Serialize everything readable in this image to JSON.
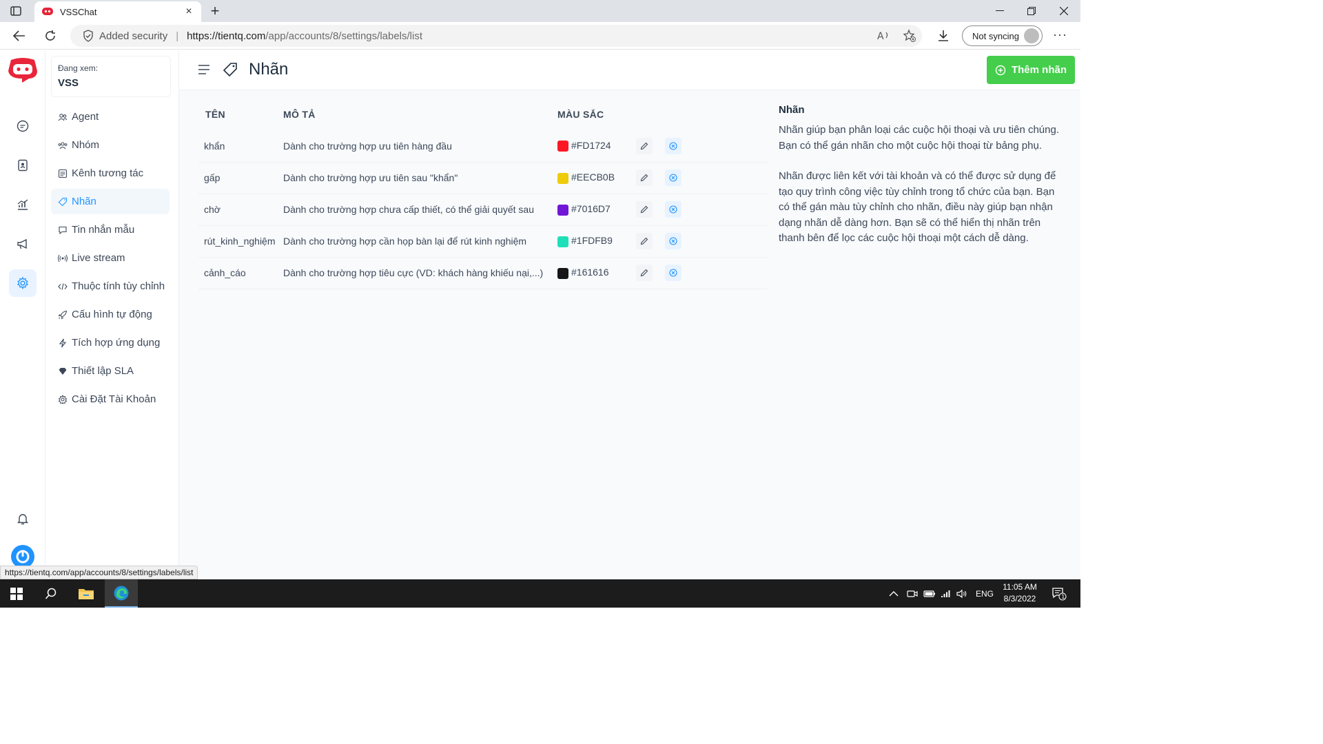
{
  "browser": {
    "tab_title": "VSSChat",
    "security_text": "Added security",
    "url_host": "https://tientq.com",
    "url_path": "/app/accounts/8/settings/labels/list",
    "sync_label": "Not syncing",
    "status_url": "https://tientq.com/app/accounts/8/settings/labels/list"
  },
  "sidebar": {
    "viewing_label": "Đang xem:",
    "account_name": "VSS",
    "items": [
      {
        "label": "Agent",
        "icon": "people-icon"
      },
      {
        "label": "Nhóm",
        "icon": "team-icon"
      },
      {
        "label": "Kênh tương tác",
        "icon": "inbox-icon"
      },
      {
        "label": "Nhãn",
        "icon": "tag-icon"
      },
      {
        "label": "Tin nhắn mẫu",
        "icon": "chat-icon"
      },
      {
        "label": "Live stream",
        "icon": "broadcast-icon"
      },
      {
        "label": "Thuộc tính tùy chỉnh",
        "icon": "code-icon"
      },
      {
        "label": "Cấu hình tự động",
        "icon": "automation-icon"
      },
      {
        "label": "Tích hợp ứng dụng",
        "icon": "flash-icon"
      },
      {
        "label": "Thiết lập SLA",
        "icon": "diamond-icon"
      },
      {
        "label": "Cài Đặt Tài Khoản",
        "icon": "gear-icon"
      }
    ]
  },
  "header": {
    "title": "Nhãn",
    "add_button": "Thêm nhãn"
  },
  "table": {
    "columns": [
      "TÊN",
      "MÔ TẢ",
      "MÀU SẮC"
    ],
    "rows": [
      {
        "name": "khẩn",
        "description": "Dành cho trường hợp ưu tiên hàng đầu",
        "color": "#FD1724"
      },
      {
        "name": "gấp",
        "description": "Dành cho trường hợp ưu tiên sau \"khẩn\"",
        "color": "#EECB0B"
      },
      {
        "name": "chờ",
        "description": "Dành cho trường hợp chưa cấp thiết, có thể giải quyết sau",
        "color": "#7016D7"
      },
      {
        "name": "rút_kinh_nghiệm",
        "description": "Dành cho trường hợp cần họp bàn lại để rút kinh nghiệm",
        "color": "#1FDFB9"
      },
      {
        "name": "cảnh_cáo",
        "description": "Dành cho trường hợp tiêu cực (VD: khách hàng khiếu nại,...)",
        "color": "#161616"
      }
    ]
  },
  "help": {
    "title": "Nhãn",
    "paragraph1": "Nhãn giúp bạn phân loại các cuộc hội thoại và ưu tiên chúng. Bạn có thể gán nhãn cho một cuộc hội thoại từ bảng phụ.",
    "paragraph2": "Nhãn được liên kết với tài khoản và có thể được sử dụng để tạo quy trình công việc tùy chỉnh trong tổ chức của bạn. Bạn có thể gán màu tùy chỉnh cho nhãn, điều này giúp bạn nhận dạng nhãn dễ dàng hơn. Bạn sẽ có thể hiển thị nhãn trên thanh bên để lọc các cuộc hội thoại một cách dễ dàng."
  },
  "taskbar": {
    "language": "ENG",
    "time": "11:05 AM",
    "date": "8/3/2022",
    "notification_count": "1"
  },
  "colors": {
    "accent": "#1f93ff",
    "add_button": "#44ce4b",
    "brand_red": "#e8253a"
  }
}
